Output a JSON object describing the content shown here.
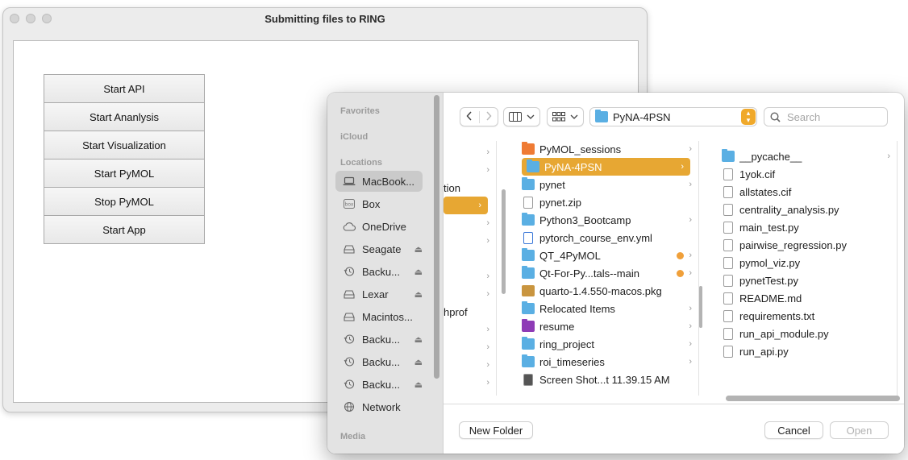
{
  "window": {
    "title": "Submitting files to RING",
    "buttons": [
      "Start API",
      "Start Ananlysis",
      "Start Visualization",
      "Start PyMOL",
      "Stop PyMOL",
      "Start App"
    ]
  },
  "dialog": {
    "sidebar": {
      "favorites_heading": "Favorites",
      "icloud_heading": "iCloud",
      "locations_heading": "Locations",
      "locations": [
        {
          "label": "MacBook...",
          "icon": "laptop-icon",
          "eject": false,
          "selected": true
        },
        {
          "label": "Box",
          "icon": "box-icon",
          "eject": false
        },
        {
          "label": "OneDrive",
          "icon": "cloud-icon",
          "eject": false
        },
        {
          "label": "Seagate",
          "icon": "drive-icon",
          "eject": true
        },
        {
          "label": "Backu...",
          "icon": "time-machine-icon",
          "eject": true
        },
        {
          "label": "Lexar",
          "icon": "drive-icon",
          "eject": true
        },
        {
          "label": "Macintos...",
          "icon": "drive-icon",
          "eject": false
        },
        {
          "label": "Backu...",
          "icon": "time-machine-icon",
          "eject": true
        },
        {
          "label": "Backu...",
          "icon": "time-machine-icon",
          "eject": true
        },
        {
          "label": "Backu...",
          "icon": "time-machine-icon",
          "eject": true
        },
        {
          "label": "Network",
          "icon": "globe-icon",
          "eject": false
        }
      ],
      "media_heading": "Media"
    },
    "toolbar": {
      "path": "PyNA-4PSN",
      "search_placeholder": "Search"
    },
    "column1": {
      "partial_labels": [
        "tion",
        "hprof"
      ]
    },
    "column2": {
      "items": [
        {
          "name": "PyMOL_sessions",
          "icon": "folder-orange",
          "chevron": true
        },
        {
          "name": "PyNA-4PSN",
          "icon": "folder",
          "chevron": true,
          "selected": true
        },
        {
          "name": "pynet",
          "icon": "folder",
          "chevron": true
        },
        {
          "name": "pynet.zip",
          "icon": "zip-file",
          "chevron": false
        },
        {
          "name": "Python3_Bootcamp",
          "icon": "folder",
          "chevron": true
        },
        {
          "name": "pytorch_course_env.yml",
          "icon": "yml-file",
          "chevron": false
        },
        {
          "name": "QT_4PyMOL",
          "icon": "folder",
          "chevron": true,
          "tag": true
        },
        {
          "name": "Qt-For-Py...tals--main",
          "icon": "folder",
          "chevron": true,
          "tag": true
        },
        {
          "name": "quarto-1.4.550-macos.pkg",
          "icon": "package",
          "chevron": false
        },
        {
          "name": "Relocated Items",
          "icon": "folder-alias",
          "chevron": true
        },
        {
          "name": "resume",
          "icon": "folder-purple",
          "chevron": true
        },
        {
          "name": "ring_project",
          "icon": "folder",
          "chevron": true
        },
        {
          "name": "roi_timeseries",
          "icon": "folder",
          "chevron": true
        },
        {
          "name": "Screen Shot...t 11.39.15 AM",
          "icon": "image-file",
          "chevron": false
        }
      ]
    },
    "column3": {
      "items": [
        {
          "name": "__pycache__",
          "icon": "folder",
          "chevron": true
        },
        {
          "name": "1yok.cif",
          "icon": "doc"
        },
        {
          "name": "allstates.cif",
          "icon": "doc"
        },
        {
          "name": "centrality_analysis.py",
          "icon": "doc"
        },
        {
          "name": "main_test.py",
          "icon": "doc"
        },
        {
          "name": "pairwise_regression.py",
          "icon": "doc"
        },
        {
          "name": "pymol_viz.py",
          "icon": "doc"
        },
        {
          "name": "pynetTest.py",
          "icon": "doc"
        },
        {
          "name": "README.md",
          "icon": "doc"
        },
        {
          "name": "requirements.txt",
          "icon": "doc"
        },
        {
          "name": "run_api_module.py",
          "icon": "doc"
        },
        {
          "name": "run_api.py",
          "icon": "doc"
        }
      ]
    },
    "footer": {
      "new_folder": "New Folder",
      "cancel": "Cancel",
      "open": "Open"
    }
  }
}
